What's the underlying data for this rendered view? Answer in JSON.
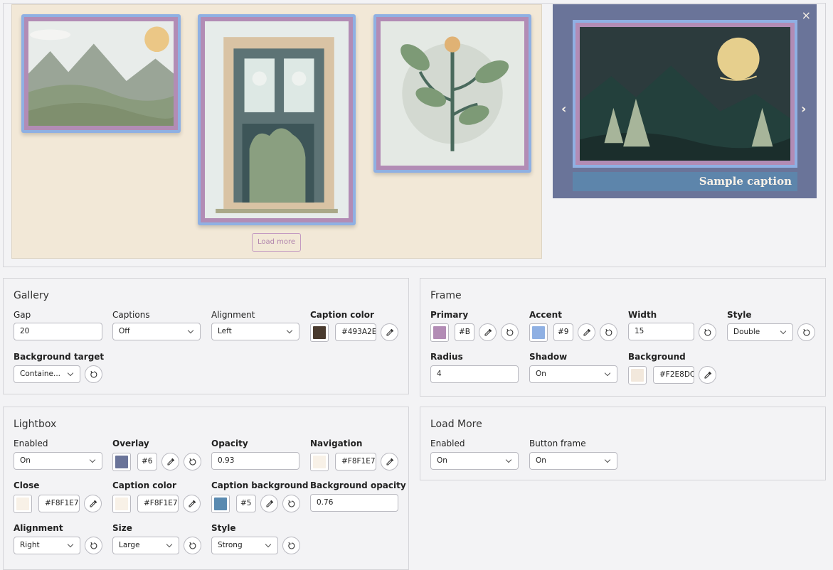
{
  "load_more_label": "Load more",
  "lightbox": {
    "close_symbol": "×",
    "prev_symbol": "‹",
    "next_symbol": "›",
    "caption": "Sample caption"
  },
  "gallery_panel": {
    "title": "Gallery",
    "gap_label": "Gap",
    "gap_value": "20",
    "captions_label": "Captions",
    "captions_value": "Off",
    "alignment_label": "Alignment",
    "alignment_value": "Left",
    "caption_color_label": "Caption color",
    "caption_color_value": "#493A2E",
    "background_target_label": "Background target",
    "background_target_value": "Containe..."
  },
  "frame_panel": {
    "title": "Frame",
    "primary_label": "Primary",
    "primary_value": "#B",
    "accent_label": "Accent",
    "accent_value": "#9",
    "width_label": "Width",
    "width_value": "15",
    "style_label": "Style",
    "style_value": "Double",
    "radius_label": "Radius",
    "radius_value": "4",
    "shadow_label": "Shadow",
    "shadow_value": "On",
    "background_label": "Background",
    "background_value": "#F2E8DC"
  },
  "lightbox_panel": {
    "title": "Lightbox",
    "enabled_label": "Enabled",
    "enabled_value": "On",
    "overlay_label": "Overlay",
    "overlay_value": "#6",
    "opacity_label": "Opacity",
    "opacity_value": "0.93",
    "navigation_label": "Navigation",
    "navigation_value": "#F8F1E7",
    "close_label": "Close",
    "close_value": "#F8F1E7",
    "caption_color_label": "Caption color",
    "caption_color_value": "#F8F1E7",
    "caption_bg_label": "Caption background",
    "caption_bg_value": "#5",
    "bg_opacity_label": "Background opacity",
    "bg_opacity_value": "0.76",
    "alignment_label": "Alignment",
    "alignment_value": "Right",
    "size_label": "Size",
    "size_value": "Large",
    "style_label": "Style",
    "style_value": "Strong"
  },
  "load_more_panel": {
    "title": "Load More",
    "enabled_label": "Enabled",
    "enabled_value": "On",
    "button_frame_label": "Button frame",
    "button_frame_value": "On"
  },
  "colors": {
    "caption_color": "#493A2E",
    "frame_primary": "#B28CB5",
    "frame_accent": "#8FB0E3",
    "frame_background": "#F2E8DC",
    "overlay": "#6A7499",
    "navigation": "#F8F1E7",
    "close": "#F8F1E7",
    "lb_caption_color": "#F8F1E7",
    "lb_caption_background": "#5A8AB0"
  }
}
